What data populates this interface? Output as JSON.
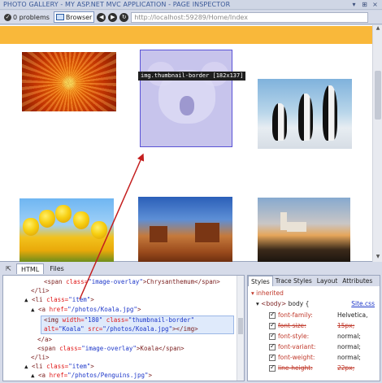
{
  "window": {
    "title": "PHOTO GALLERY - MY ASP.NET MVC APPLICATION - PAGE INSPECTOR"
  },
  "toolbar": {
    "problems_label": "0 problems",
    "browser_label": "Browser",
    "url": "http://localhost:59289/Home/Index"
  },
  "page": {
    "tooltip": "img.thumbnail-border [182x137]"
  },
  "panel_tabs": {
    "html_tab": "HTML",
    "files_tab": "Files"
  },
  "html_code": {
    "line1_pre": "<span ",
    "line1_attr": "class=",
    "line1_val": "\"image-overlay\"",
    "line1_post": ">Chrysanthemum</span>",
    "line2": "</li>",
    "line3_pre": "<li ",
    "line3_attr": "class=",
    "line3_val": "\"item\"",
    "line3_post": ">",
    "line4_pre": "<a ",
    "line4_attr": "href=",
    "line4_val": "\"/photos/Koala.jpg\"",
    "line4_post": ">",
    "line5_pre": "<img ",
    "line5_attr1": "width=",
    "line5_val1": "\"180\"",
    "line5_attr2": " class=",
    "line5_val2": "\"thumbnail-border\"",
    "line6_attr1": "alt=",
    "line6_val1": "\"Koala\"",
    "line6_attr2": " src=",
    "line6_val2": "\"/photos/Koala.jpg\"",
    "line6_post": "></img>",
    "line7": "</a>",
    "line8_pre": "<span ",
    "line8_attr": "class=",
    "line8_val": "\"image-overlay\"",
    "line8_post": ">Koala</span>",
    "line9": "</li>",
    "line10_pre": "<li ",
    "line10_attr": "class=",
    "line10_val": "\"item\"",
    "line10_post": ">",
    "line11_pre": "<a ",
    "line11_attr": "href=",
    "line11_val": "\"/photos/Penguins.jpg\"",
    "line11_post": ">"
  },
  "styles_panel": {
    "tabs": [
      "Styles",
      "Trace Styles",
      "Layout",
      "Attributes"
    ],
    "inherited": "inherited",
    "rule_selector_tag": "<body>",
    "rule_selector": " body {",
    "source": "Site.css",
    "properties": [
      {
        "name": "font-family:",
        "value": "Helvetica,",
        "overridden": false
      },
      {
        "name": "font-size:",
        "value": "15px;",
        "overridden": true
      },
      {
        "name": "font-style:",
        "value": "normal;",
        "overridden": false
      },
      {
        "name": "font-variant:",
        "value": "normal;",
        "overridden": false
      },
      {
        "name": "font-weight:",
        "value": "normal;",
        "overridden": false
      },
      {
        "name": "line-height:",
        "value": "22px;",
        "overridden": true
      }
    ]
  },
  "icons": {
    "problems": "problems-icon",
    "browser": "browser-icon",
    "back": "back-arrow-icon",
    "forward": "forward-arrow-icon",
    "refresh": "refresh-icon",
    "select": "select-element-icon"
  },
  "colors": {
    "banner": "#f9b83a",
    "selection": "#dfeafb",
    "arrow": "#c41e1e"
  }
}
